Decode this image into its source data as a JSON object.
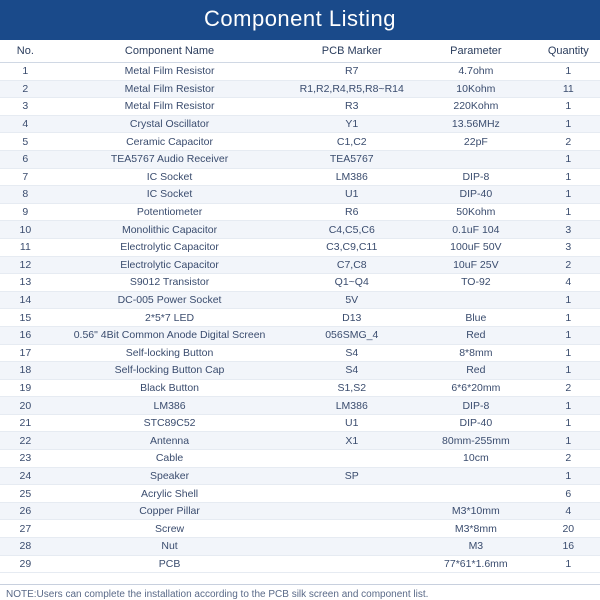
{
  "title": "Component Listing",
  "columns": {
    "no": "No.",
    "name": "Component Name",
    "marker": "PCB Marker",
    "param": "Parameter",
    "qty": "Quantity"
  },
  "rows": [
    {
      "no": "1",
      "name": "Metal Film Resistor",
      "marker": "R7",
      "param": "4.7ohm",
      "qty": "1"
    },
    {
      "no": "2",
      "name": "Metal Film Resistor",
      "marker": "R1,R2,R4,R5,R8~R14",
      "param": "10Kohm",
      "qty": "11"
    },
    {
      "no": "3",
      "name": "Metal Film Resistor",
      "marker": "R3",
      "param": "220Kohm",
      "qty": "1"
    },
    {
      "no": "4",
      "name": "Crystal Oscillator",
      "marker": "Y1",
      "param": "13.56MHz",
      "qty": "1"
    },
    {
      "no": "5",
      "name": "Ceramic Capacitor",
      "marker": "C1,C2",
      "param": "22pF",
      "qty": "2"
    },
    {
      "no": "6",
      "name": "TEA5767 Audio Receiver",
      "marker": "TEA5767",
      "param": "",
      "qty": "1"
    },
    {
      "no": "7",
      "name": "IC Socket",
      "marker": "LM386",
      "param": "DIP-8",
      "qty": "1"
    },
    {
      "no": "8",
      "name": "IC Socket",
      "marker": "U1",
      "param": "DIP-40",
      "qty": "1"
    },
    {
      "no": "9",
      "name": "Potentiometer",
      "marker": "R6",
      "param": "50Kohm",
      "qty": "1"
    },
    {
      "no": "10",
      "name": "Monolithic Capacitor",
      "marker": "C4,C5,C6",
      "param": "0.1uF 104",
      "qty": "3"
    },
    {
      "no": "11",
      "name": "Electrolytic Capacitor",
      "marker": "C3,C9,C11",
      "param": "100uF 50V",
      "qty": "3"
    },
    {
      "no": "12",
      "name": "Electrolytic Capacitor",
      "marker": "C7,C8",
      "param": "10uF 25V",
      "qty": "2"
    },
    {
      "no": "13",
      "name": "S9012 Transistor",
      "marker": "Q1~Q4",
      "param": "TO-92",
      "qty": "4"
    },
    {
      "no": "14",
      "name": "DC-005 Power Socket",
      "marker": "5V",
      "param": "",
      "qty": "1"
    },
    {
      "no": "15",
      "name": "2*5*7 LED",
      "marker": "D13",
      "param": "Blue",
      "qty": "1"
    },
    {
      "no": "16",
      "name": "0.56\" 4Bit Common Anode Digital Screen",
      "marker": "056SMG_4",
      "param": "Red",
      "qty": "1"
    },
    {
      "no": "17",
      "name": "Self-locking Button",
      "marker": "S4",
      "param": "8*8mm",
      "qty": "1"
    },
    {
      "no": "18",
      "name": "Self-locking Button Cap",
      "marker": "S4",
      "param": "Red",
      "qty": "1"
    },
    {
      "no": "19",
      "name": "Black Button",
      "marker": "S1,S2",
      "param": "6*6*20mm",
      "qty": "2"
    },
    {
      "no": "20",
      "name": "LM386",
      "marker": "LM386",
      "param": "DIP-8",
      "qty": "1"
    },
    {
      "no": "21",
      "name": "STC89C52",
      "marker": "U1",
      "param": "DIP-40",
      "qty": "1"
    },
    {
      "no": "22",
      "name": "Antenna",
      "marker": "X1",
      "param": "80mm-255mm",
      "qty": "1"
    },
    {
      "no": "23",
      "name": "Cable",
      "marker": "",
      "param": "10cm",
      "qty": "2"
    },
    {
      "no": "24",
      "name": "Speaker",
      "marker": "SP",
      "param": "",
      "qty": "1"
    },
    {
      "no": "25",
      "name": "Acrylic Shell",
      "marker": "",
      "param": "",
      "qty": "6"
    },
    {
      "no": "26",
      "name": "Copper Pillar",
      "marker": "",
      "param": "M3*10mm",
      "qty": "4"
    },
    {
      "no": "27",
      "name": "Screw",
      "marker": "",
      "param": "M3*8mm",
      "qty": "20"
    },
    {
      "no": "28",
      "name": "Nut",
      "marker": "",
      "param": "M3",
      "qty": "16"
    },
    {
      "no": "29",
      "name": "PCB",
      "marker": "",
      "param": "77*61*1.6mm",
      "qty": "1"
    }
  ],
  "note": "NOTE:Users can complete the installation according to the PCB silk screen and component list."
}
